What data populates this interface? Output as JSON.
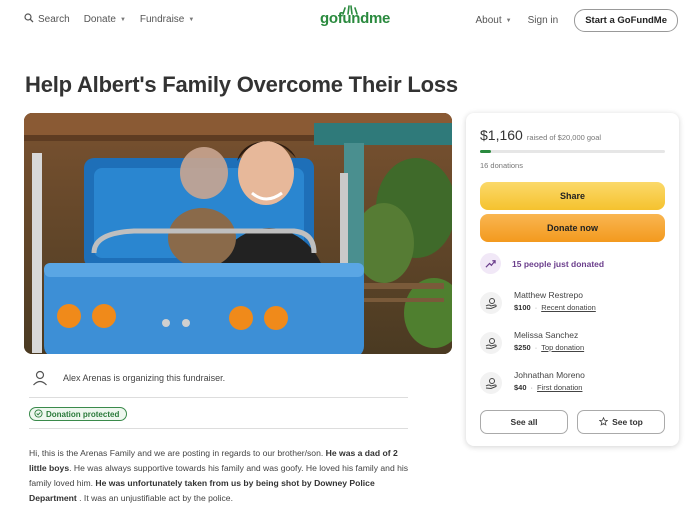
{
  "header": {
    "search": "Search",
    "donate": "Donate",
    "fundraise": "Fundraise",
    "logo": "gofundme",
    "about": "About",
    "signin": "Sign in",
    "start": "Start a GoFundMe"
  },
  "campaign": {
    "title": "Help Albert's Family Overcome Their Loss",
    "organizer": "Alex Arenas is organizing this fundraiser.",
    "protected": "Donation protected",
    "story": {
      "s1": "Hi, this is the Arenas Family and we are posting in regards to our brother/son. ",
      "s2": "He was a dad of 2 little boys",
      "s3": ". He was always supportive towards his family and was goofy. He loved his family and his family loved him. ",
      "s4": "He was unfortunately taken from us by being shot by Downey Police Department",
      "s5": " . It was an unjustifiable act by the police."
    }
  },
  "card": {
    "amount": "$1,160",
    "goal": "raised of $20,000 goal",
    "progress": 0.058,
    "count": "16 donations",
    "share": "Share",
    "donate_now": "Donate now",
    "recent_activity": "15 people just donated",
    "donors": [
      {
        "name": "Matthew Restrepo",
        "amount": "$100",
        "tag": "Recent donation"
      },
      {
        "name": "Melissa Sanchez",
        "amount": "$250",
        "tag": "Top donation"
      },
      {
        "name": "Johnathan Moreno",
        "amount": "$40",
        "tag": "First donation"
      }
    ],
    "see_all": "See all",
    "see_top": "See top"
  },
  "colors": {
    "brand_green": "#2a8a3e",
    "share_yellow": "#f5c22e",
    "donate_orange": "#f39a1e",
    "activity_purple": "#6b3e8c"
  },
  "icons": [
    "search-icon",
    "chevron-down-icon",
    "user-icon",
    "shield-check-icon",
    "trending-up-icon",
    "donation-hand-icon",
    "star-icon"
  ]
}
